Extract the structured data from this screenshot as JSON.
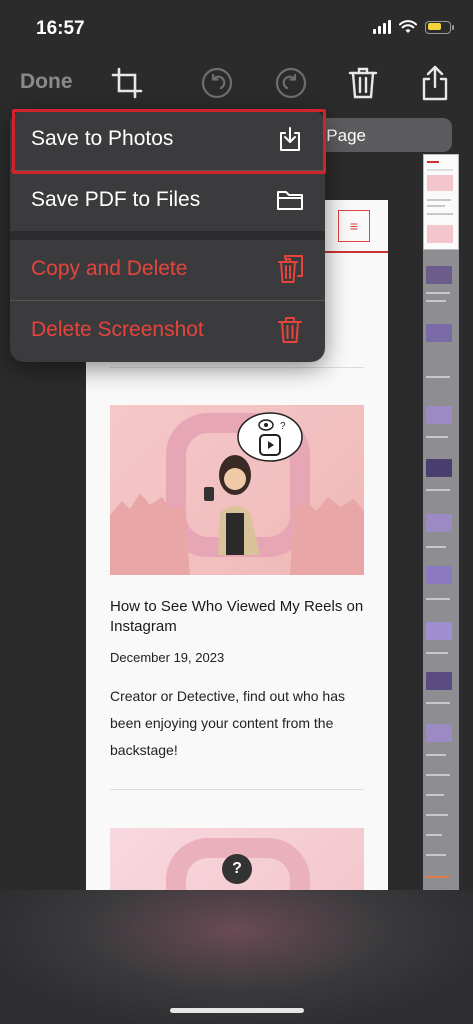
{
  "status_bar": {
    "time": "16:57"
  },
  "toolbar": {
    "done_label": "Done"
  },
  "segmented": {
    "visible_label": "ll Page"
  },
  "menu": {
    "items": [
      {
        "label": "Save to Photos",
        "icon": "save-download-icon",
        "color": "#ffffff"
      },
      {
        "label": "Save PDF to Files",
        "icon": "folder-icon",
        "color": "#ffffff"
      },
      {
        "label": "Copy and Delete",
        "icon": "copy-trash-icon",
        "color": "#e5443c"
      },
      {
        "label": "Delete Screenshot",
        "icon": "trash-icon",
        "color": "#e5443c"
      }
    ],
    "highlight_color": "#d1232a"
  },
  "article": {
    "title": "How to See Who Viewed My Reels on Instagram",
    "date": "December 19, 2023",
    "excerpt": "Creator or Detective, find out who has been enjoying your content from the backstage!"
  },
  "help": {
    "label": "?"
  },
  "colors": {
    "accent_red": "#e5443c",
    "battery": "#f5d33c"
  }
}
